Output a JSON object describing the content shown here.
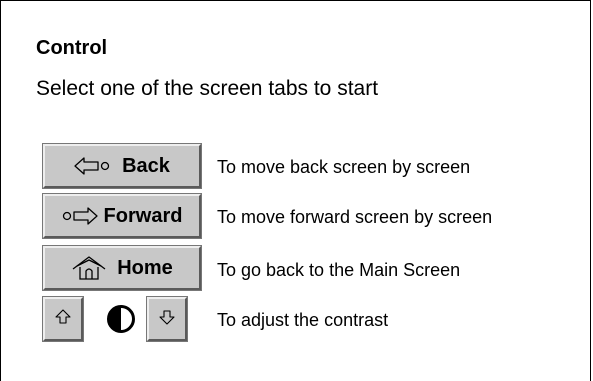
{
  "header": {
    "title": "Control",
    "subtitle": "Select one of the screen tabs to start"
  },
  "controls": {
    "back": {
      "label": "Back",
      "description": "To move back screen by screen",
      "icon": "back-arrow-icon"
    },
    "forward": {
      "label": "Forward",
      "description": "To move forward screen by screen",
      "icon": "forward-arrow-icon"
    },
    "home": {
      "label": "Home",
      "description": "To go back to the Main Screen",
      "icon": "home-icon"
    },
    "contrast": {
      "description": "To adjust the contrast",
      "up_icon": "arrow-up-icon",
      "symbol_icon": "contrast-icon",
      "down_icon": "arrow-down-icon"
    }
  },
  "colors": {
    "button_face": "#c8c8c8",
    "text": "#000000",
    "background": "#ffffff"
  }
}
